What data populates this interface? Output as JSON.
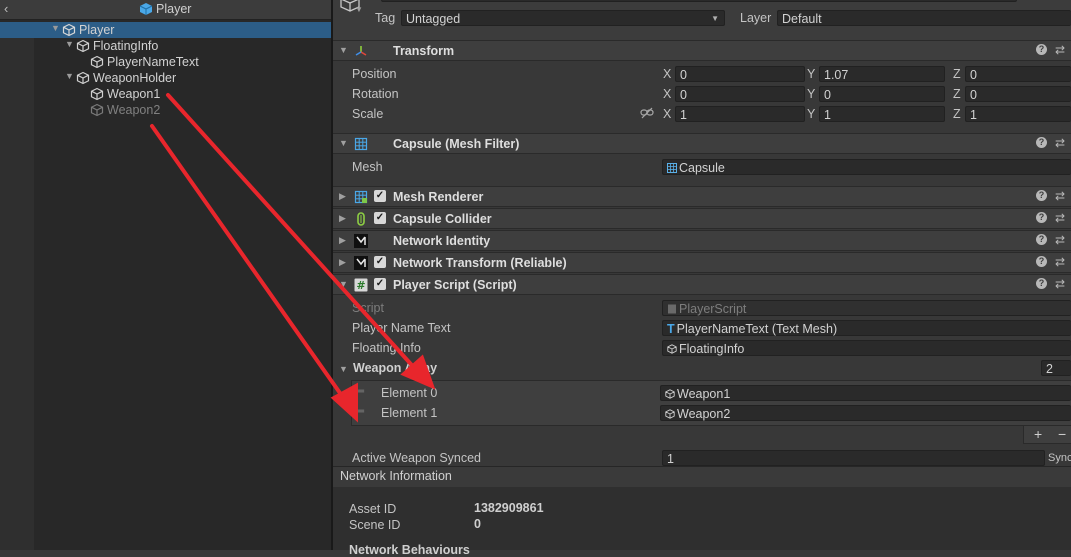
{
  "hierarchy": {
    "title": "Player",
    "items": [
      {
        "label": "Player",
        "selected": true,
        "dim": false
      },
      {
        "label": "FloatingInfo",
        "selected": false,
        "dim": false
      },
      {
        "label": "PlayerNameText",
        "selected": false,
        "dim": false
      },
      {
        "label": "WeaponHolder",
        "selected": false,
        "dim": false
      },
      {
        "label": "Weapon1",
        "selected": false,
        "dim": false
      },
      {
        "label": "Weapon2",
        "selected": false,
        "dim": true
      }
    ]
  },
  "inspector": {
    "tag_label": "Tag",
    "tag_value": "Untagged",
    "layer_label": "Layer",
    "layer_value": "Default",
    "transform": {
      "title": "Transform",
      "rows": [
        {
          "label": "Position",
          "x": "0",
          "y": "1.07",
          "z": "0"
        },
        {
          "label": "Rotation",
          "x": "0",
          "y": "0",
          "z": "0"
        },
        {
          "label": "Scale",
          "x": "1",
          "y": "1",
          "z": "1"
        }
      ],
      "axis_x": "X",
      "axis_y": "Y",
      "axis_z": "Z"
    },
    "mesh_filter": {
      "title": "Capsule (Mesh Filter)",
      "mesh_label": "Mesh",
      "mesh_value": "Capsule"
    },
    "components": [
      {
        "title": "Mesh Renderer"
      },
      {
        "title": "Capsule Collider"
      },
      {
        "title": "Network Identity"
      },
      {
        "title": "Network Transform (Reliable)"
      }
    ],
    "player_script": {
      "title": "Player Script (Script)",
      "script_label": "Script",
      "script_value": "PlayerScript",
      "name_text_label": "Player Name Text",
      "name_text_value": "PlayerNameText (Text Mesh)",
      "floating_label": "Floating Info",
      "floating_value": "FloatingInfo",
      "weapon_array_label": "Weapon Array",
      "weapon_array_size": "2",
      "elements": [
        {
          "label": "Element 0",
          "value": "Weapon1"
        },
        {
          "label": "Element 1",
          "value": "Weapon2"
        }
      ],
      "plus": "+",
      "minus": "−",
      "active_label": "Active Weapon Synced",
      "active_value": "1",
      "sync_label": "Sync"
    },
    "network_info": {
      "title": "Network Information",
      "asset_label": "Asset ID",
      "asset_value": "1382909861",
      "scene_label": "Scene ID",
      "scene_value": "0",
      "behaviours_label": "Network Behaviours"
    },
    "checkmark": "✓",
    "help_glyph": "?",
    "settings_glyph": "⇄"
  },
  "colors": {
    "selection": "#2c5d87",
    "annotation_arrow": "#e8262c"
  }
}
